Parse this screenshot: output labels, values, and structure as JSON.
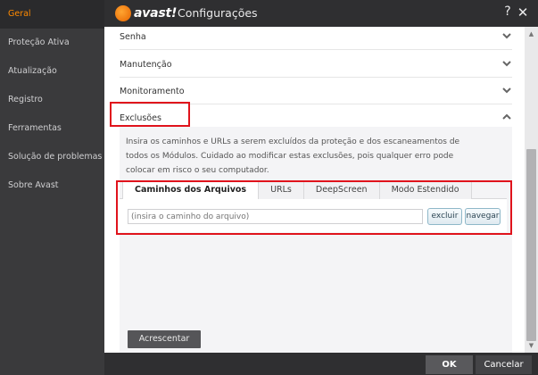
{
  "sidebar": {
    "items": [
      {
        "label": "Geral",
        "active": true
      },
      {
        "label": "Proteção Ativa",
        "active": false
      },
      {
        "label": "Atualização",
        "active": false
      },
      {
        "label": "Registro",
        "active": false
      },
      {
        "label": "Ferramentas",
        "active": false
      },
      {
        "label": "Solução de problemas",
        "active": false
      },
      {
        "label": "Sobre Avast",
        "active": false
      }
    ]
  },
  "header": {
    "logo_text": "avast!",
    "title": "Configurações",
    "help_glyph": "?",
    "close_glyph": "✕"
  },
  "sections": [
    {
      "label": "Senha",
      "expanded": false
    },
    {
      "label": "Manutenção",
      "expanded": false
    },
    {
      "label": "Monitoramento",
      "expanded": false
    },
    {
      "label": "Exclusões",
      "expanded": true
    }
  ],
  "exclusions": {
    "description": "Insira os caminhos e URLs a serem excluídos da proteção e dos escaneamentos de todos os Módulos. Cuidado ao modificar estas exclusões, pois qualquer erro pode colocar em risco o seu computador.",
    "tabs": [
      {
        "label": "Caminhos dos Arquivos",
        "active": true
      },
      {
        "label": "URLs",
        "active": false
      },
      {
        "label": "DeepScreen",
        "active": false
      },
      {
        "label": "Modo Estendido",
        "active": false
      }
    ],
    "path_placeholder": "(insira o caminho do arquivo)",
    "remove_button": "excluir",
    "browse_button": "navegar",
    "add_button": "Acrescentar"
  },
  "footer": {
    "ok_label": "OK",
    "cancel_label": "Cancelar"
  },
  "colors": {
    "accent_orange": "#ff8a00",
    "highlight_red": "#e0131c",
    "dark_bg": "#2f2f31"
  }
}
